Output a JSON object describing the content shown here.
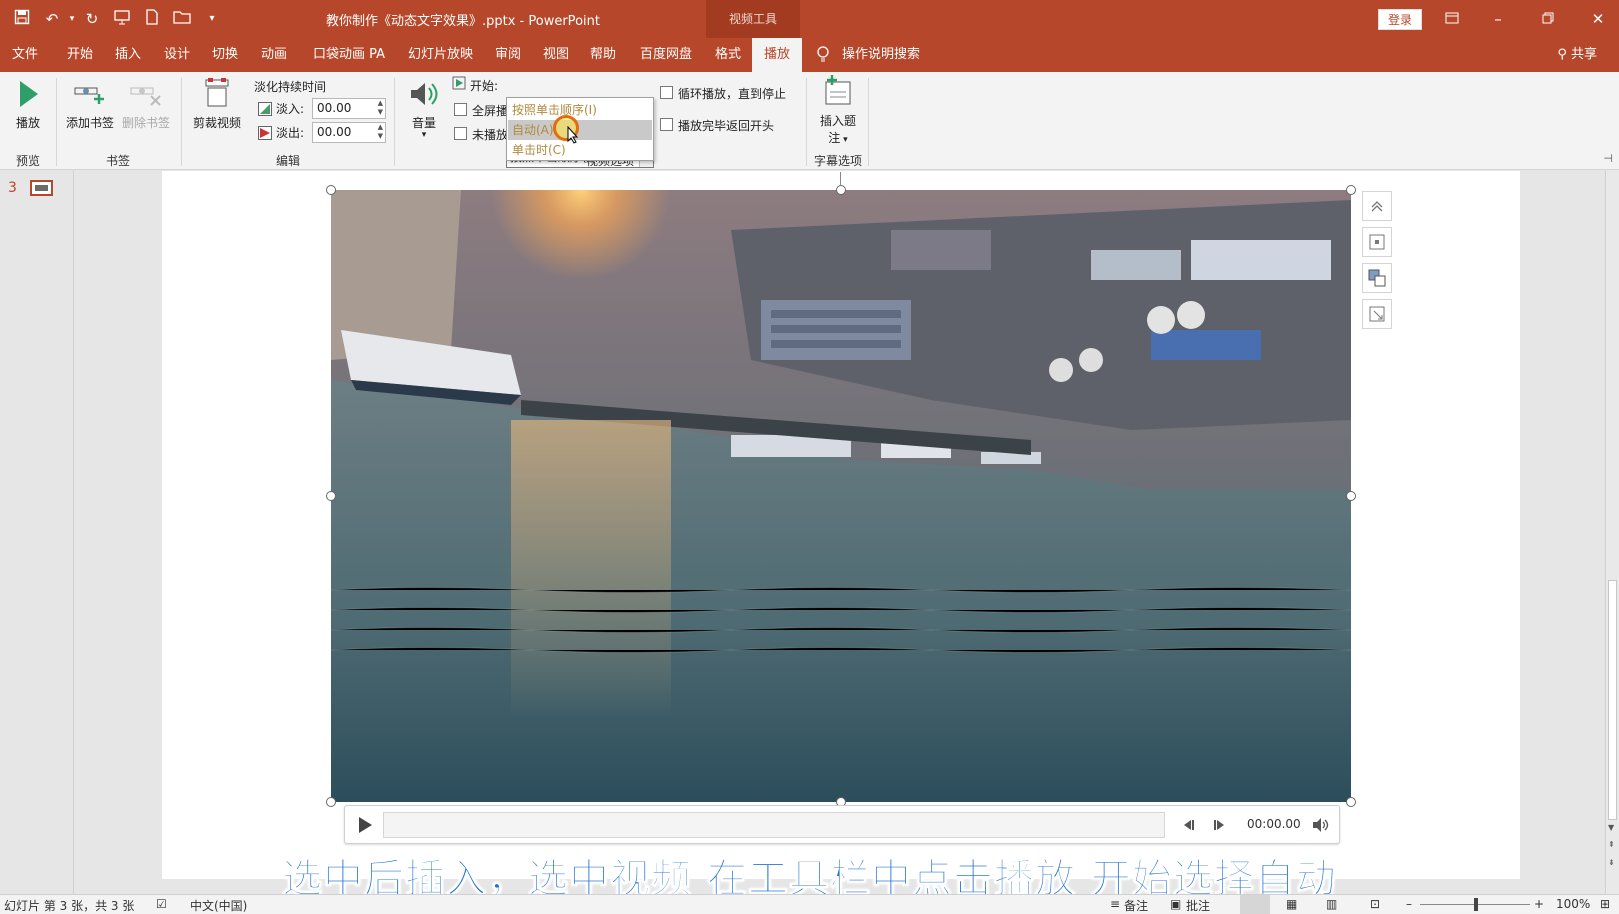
{
  "titlebar": {
    "document_title": "教你制作《动态文字效果》.pptx  -  PowerPoint",
    "context_group": "视频工具",
    "login": "登录",
    "quick_more": "▾"
  },
  "tabs": {
    "file": "文件",
    "home": "开始",
    "insert": "插入",
    "design": "设计",
    "transitions": "切换",
    "animations": "动画",
    "pocket": "口袋动画 PA",
    "slideshow": "幻灯片放映",
    "review": "审阅",
    "view": "视图",
    "help": "帮助",
    "baidu": "百度网盘",
    "format": "格式",
    "playback": "播放",
    "tell_me": "操作说明搜索",
    "share": "共享"
  },
  "ribbon": {
    "preview": {
      "play": "播放",
      "label": "预览"
    },
    "bookmarks": {
      "add": "添加书签",
      "remove": "删除书签",
      "label": "书签"
    },
    "editing": {
      "trim": "剪裁视频",
      "fade_title": "淡化持续时间",
      "fade_in_label": "淡入:",
      "fade_in_value": "00.00",
      "fade_out_label": "淡出:",
      "fade_out_value": "00.00",
      "label": "编辑"
    },
    "video_options": {
      "volume": "音量",
      "start_label": "开始:",
      "start_value": "按照单击顺序(I)",
      "fullscreen": "全屏播",
      "hide": "未播放",
      "group_label": "视频选项",
      "loop": "循环播放，直到停止",
      "rewind": "播放完毕返回开头",
      "options": [
        "按照单击顺序(I)",
        "自动(A)",
        "单击时(C)"
      ]
    },
    "captions": {
      "insert": "插入题",
      "insert2": "注",
      "label": "字幕选项"
    }
  },
  "thumbnail": {
    "slide_number": "3"
  },
  "player": {
    "time": "00:00.00"
  },
  "subtitle": "选中后插入，选中视频 在工具栏中点击播放 开始选择自动",
  "statusbar": {
    "slide_info": "幻灯片 第 3 张，共 3 张",
    "language": "中文(中国)",
    "notes": "备注",
    "comments": "批注",
    "zoom": "100%"
  },
  "colors": {
    "accent": "#b7472a",
    "subtitle": "#1d6fd8",
    "cursor_ring": "#e46b0e"
  }
}
